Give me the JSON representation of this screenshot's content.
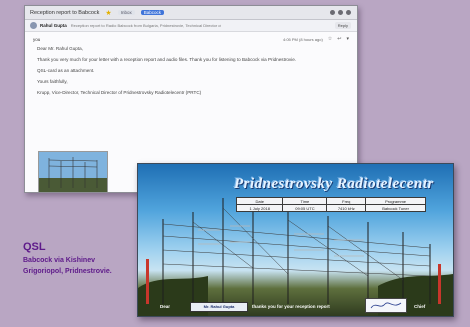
{
  "email": {
    "subject": "Reception report to Babcock",
    "chip_inbox": "Inbox",
    "chip_label": "Babcock",
    "sender": "Rahul Gupta",
    "snippet": "Reception report to Radio Babcock from Bulgaria, Pridnestrovie, Technical Director of",
    "reply_label": "Reply",
    "from_name": "you",
    "date": "4:05 PM (8 hours ago)",
    "paragraphs": [
      "Dear Mr. Rahul Gupta,",
      "Thank you very much for your letter with a reception report and audio files. Thank you for listening to Babcock via Pridnestrovie.",
      "QSL-card as an attachment.",
      "Yours faithfully,",
      "Krupp, Vice-Director, Technical Director of Pridnestrovsky Radiotelecentr (PRTC)"
    ]
  },
  "qsl_card": {
    "title": "Pridnestrovsky Radiotelecentr",
    "log_headers": [
      "Date",
      "Time",
      "Freq",
      "Programme"
    ],
    "log_row": [
      "1 July 2018",
      "09:05 UTC",
      "7410 kHz",
      "Babcock Tuner"
    ],
    "footer_to": "Dear",
    "recipient": "Mr. Rahul Gupta",
    "footer_mid": "thanks you for your reception report",
    "footer_right": "Chief"
  },
  "caption": {
    "title": "QSL",
    "subtitle": "Babcock via Kishinev Grigoriopol, Pridnestrovie."
  }
}
